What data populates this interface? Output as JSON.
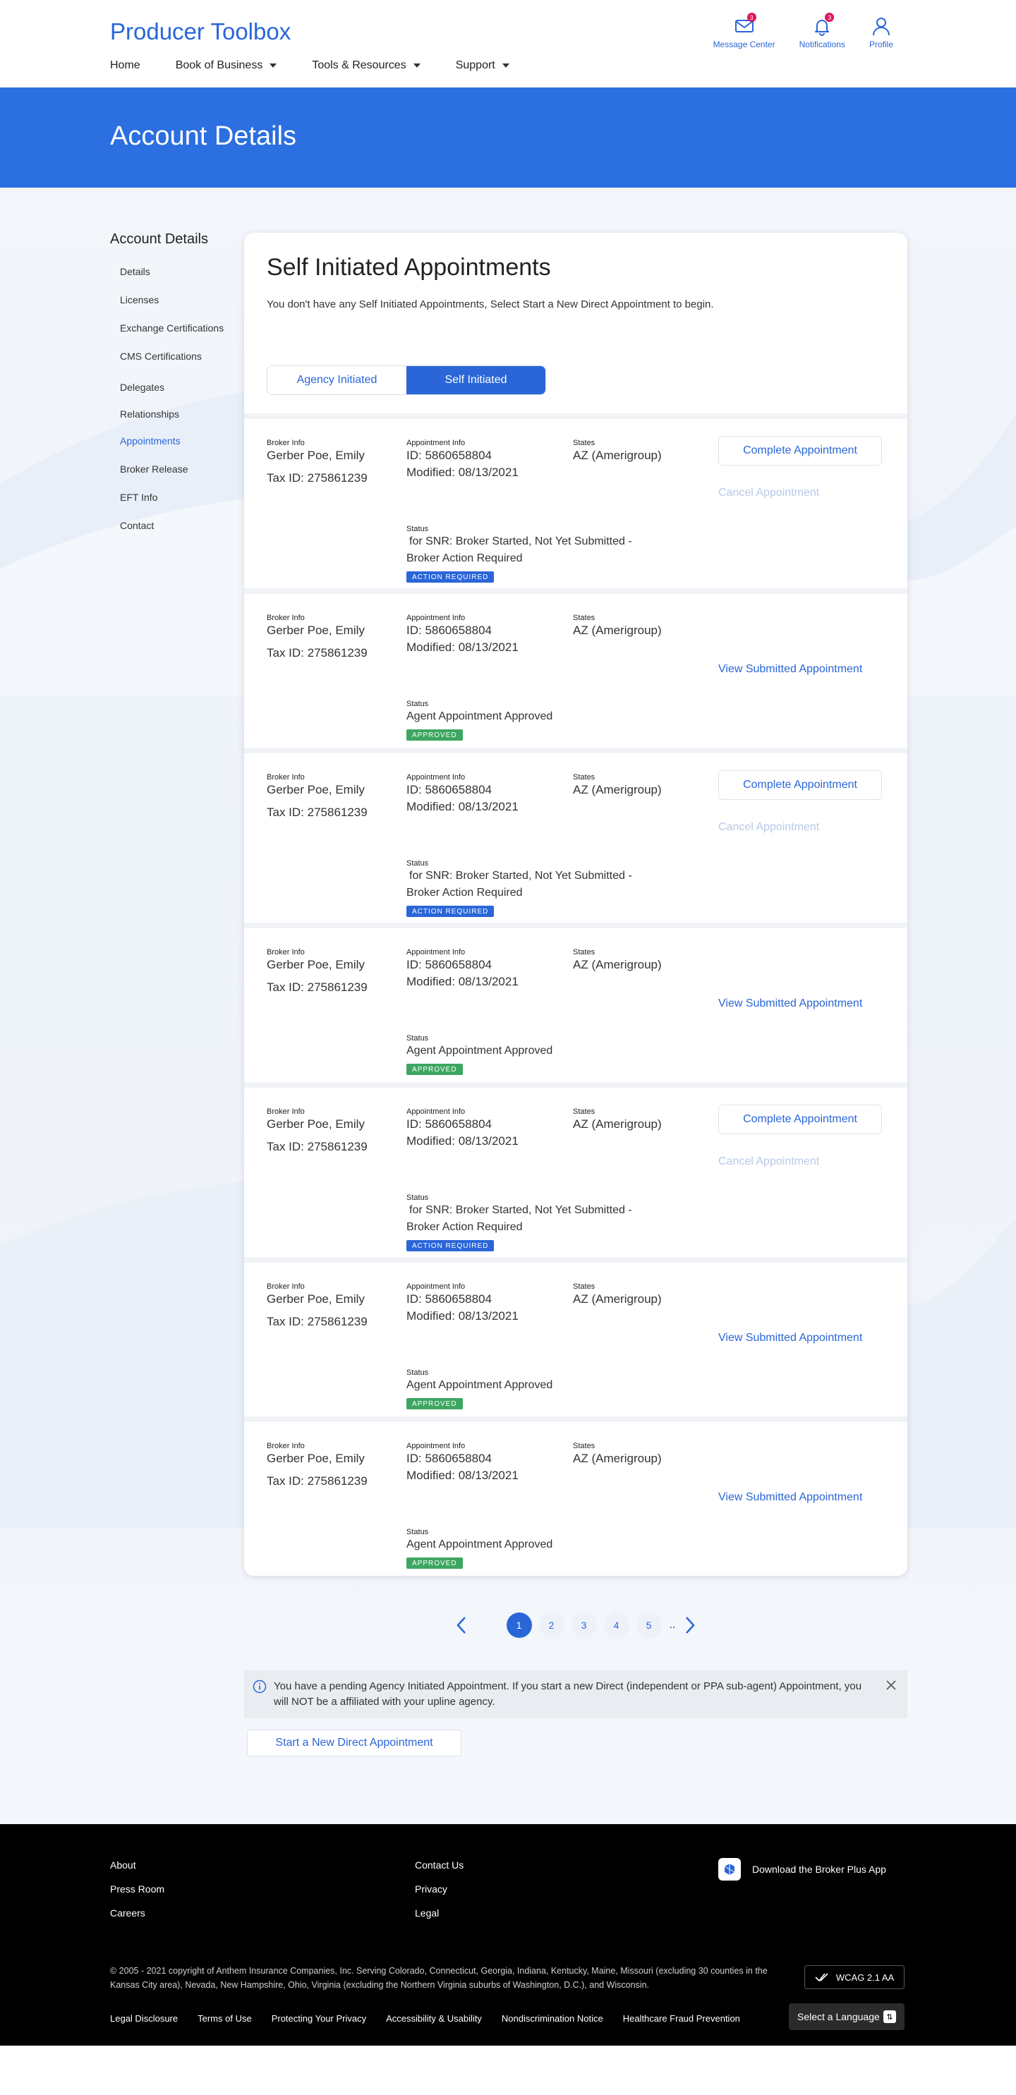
{
  "header": {
    "brand": "Producer Toolbox",
    "nav": [
      {
        "label": "Home",
        "caret": false
      },
      {
        "label": "Book of Business",
        "caret": true
      },
      {
        "label": "Tools & Resources",
        "caret": true
      },
      {
        "label": "Support",
        "caret": true
      }
    ],
    "icons": [
      {
        "name": "message-center",
        "label": "Message Center",
        "badge": "3",
        "icon": "envelope-icon"
      },
      {
        "name": "notifications",
        "label": "Notifications",
        "badge": "3",
        "icon": "bell-icon"
      },
      {
        "name": "profile",
        "label": "Profile",
        "badge": "",
        "icon": "user-icon"
      }
    ]
  },
  "hero": {
    "title": "Account Details"
  },
  "sidebar": {
    "title": "Account Details",
    "items": [
      {
        "label": "Details",
        "active": false
      },
      {
        "label": "Licenses",
        "active": false
      },
      {
        "label": "Exchange Certifications",
        "active": false
      },
      {
        "label": "CMS Certifications",
        "active": false
      },
      {
        "label": "Delegates",
        "active": false
      },
      {
        "label": "Relationships",
        "active": false
      },
      {
        "label": "Appointments",
        "active": true
      },
      {
        "label": "Broker Release",
        "active": false
      },
      {
        "label": "EFT Info",
        "active": false
      },
      {
        "label": "Contact",
        "active": false
      }
    ]
  },
  "card": {
    "title": "Self Initiated Appointments",
    "description": "You don't have any Self Initiated Appointments, Select Start a New Direct Appointment to begin.",
    "toggle": [
      {
        "label": "Agency Initiated",
        "selected": false
      },
      {
        "label": "Self Initiated",
        "selected": true
      }
    ],
    "labels": {
      "broker_info": "Broker Info",
      "appointment_info": "Appointment Info",
      "states": "States",
      "status": "Status"
    },
    "actions": {
      "complete": "Complete Appointment",
      "cancel": "Cancel Appointment",
      "view": "View Submitted Appointment"
    },
    "appointments": [
      {
        "broker_name": "Gerber Poe, Emily",
        "tax_id": "Tax ID: 275861239",
        "appt_id": "ID: 5860658804",
        "modified": "Modified: 08/13/2021",
        "states": "AZ (Amerigroup)",
        "status_line1": "for SNR: Broker Started, Not Yet Submitted -",
        "status_line2": "Broker Action Required",
        "badge": "ACTION REQUIRED",
        "kind": "action"
      },
      {
        "broker_name": "Gerber Poe, Emily",
        "tax_id": "Tax ID: 275861239",
        "appt_id": "ID: 5860658804",
        "modified": "Modified: 08/13/2021",
        "states": "AZ (Amerigroup)",
        "status_line1": "Agent Appointment Approved",
        "status_line2": "",
        "badge": "APPROVED",
        "kind": "approved"
      },
      {
        "broker_name": "Gerber Poe, Emily",
        "tax_id": "Tax ID: 275861239",
        "appt_id": "ID: 5860658804",
        "modified": "Modified: 08/13/2021",
        "states": "AZ (Amerigroup)",
        "status_line1": "for SNR: Broker Started, Not Yet Submitted -",
        "status_line2": "Broker Action Required",
        "badge": "ACTION REQUIRED",
        "kind": "action"
      },
      {
        "broker_name": "Gerber Poe, Emily",
        "tax_id": "Tax ID: 275861239",
        "appt_id": "ID: 5860658804",
        "modified": "Modified: 08/13/2021",
        "states": "AZ (Amerigroup)",
        "status_line1": "Agent Appointment Approved",
        "status_line2": "",
        "badge": "APPROVED",
        "kind": "approved"
      },
      {
        "broker_name": "Gerber Poe, Emily",
        "tax_id": "Tax ID: 275861239",
        "appt_id": "ID: 5860658804",
        "modified": "Modified: 08/13/2021",
        "states": "AZ (Amerigroup)",
        "status_line1": "for SNR: Broker Started, Not Yet Submitted -",
        "status_line2": "Broker Action Required",
        "badge": "ACTION REQUIRED",
        "kind": "action"
      },
      {
        "broker_name": "Gerber Poe, Emily",
        "tax_id": "Tax ID: 275861239",
        "appt_id": "ID: 5860658804",
        "modified": "Modified: 08/13/2021",
        "states": "AZ (Amerigroup)",
        "status_line1": "Agent Appointment Approved",
        "status_line2": "",
        "badge": "APPROVED",
        "kind": "approved"
      },
      {
        "broker_name": "Gerber Poe, Emily",
        "tax_id": "Tax ID: 275861239",
        "appt_id": "ID: 5860658804",
        "modified": "Modified: 08/13/2021",
        "states": "AZ (Amerigroup)",
        "status_line1": "Agent Appointment Approved",
        "status_line2": "",
        "badge": "APPROVED",
        "kind": "approved"
      }
    ]
  },
  "pagination": {
    "pages": [
      "1",
      "2",
      "3",
      "4",
      "5"
    ],
    "current": "1",
    "ellipsis": ".."
  },
  "notice": {
    "text": "You have a pending Agency Initiated Appointment. If you start a new Direct (independent or PPA sub-agent) Appointment, you will NOT be a affiliated with your upline agency."
  },
  "start_button": "Start a New Direct Appointment",
  "footer": {
    "col1": [
      "About",
      "Press Room",
      "Careers"
    ],
    "col2": [
      "Contact Us",
      "Privacy",
      "Legal"
    ],
    "app_download": "Download the Broker Plus App",
    "copyright": "© 2005 - 2021 copyright of Anthem Insurance Companies, Inc. Serving Colorado, Connecticut, Georgia, Indiana, Kentucky, Maine, Missouri (excluding 30 counties in the Kansas City area), Nevada, New Hampshire, Ohio, Virginia (excluding the Northern Virginia suburbs of Washington, D.C.), and Wisconsin.",
    "wcag": "WCAG 2.1 AA",
    "legal_links": [
      "Legal Disclosure",
      "Terms of Use",
      "Protecting Your Privacy",
      "Accessibility & Usability",
      "Nondiscrimination Notice",
      "Healthcare Fraud Prevention"
    ],
    "language": "Select a Language"
  },
  "colors": {
    "brand": "#2a66d8",
    "hero": "#2b6fe0",
    "action": "#2a66d8",
    "approved": "#3da661",
    "badge": "#e0145a"
  }
}
